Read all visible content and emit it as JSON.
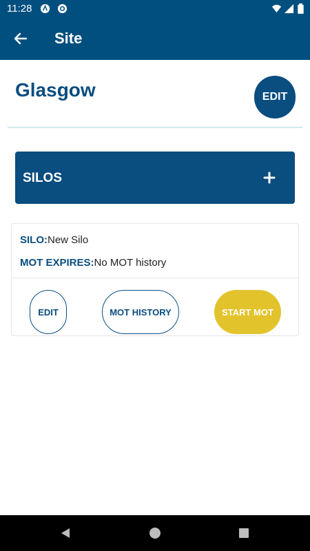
{
  "status_bar": {
    "time": "11:28",
    "icons": [
      "app-notification-icon",
      "at-sign-icon",
      "wifi-icon",
      "signal-icon",
      "battery-icon"
    ]
  },
  "app_bar": {
    "title": "Site",
    "back_icon": "back-arrow-icon"
  },
  "site": {
    "name": "Glasgow",
    "edit_label": "EDIT"
  },
  "silos_section": {
    "title": "SILOS",
    "add_icon": "plus-icon"
  },
  "silo_card": {
    "silo_key": "SILO:",
    "silo_value": "New Silo",
    "mot_key": "MOT EXPIRES:",
    "mot_value": "No MOT history",
    "edit_label": "EDIT",
    "history_label": "MOT HISTORY",
    "start_label": "START MOT"
  },
  "nav_bar": {
    "icons": [
      "back-triangle-icon",
      "home-circle-icon",
      "recents-square-icon"
    ]
  },
  "colors": {
    "primary": "#0a4d7f",
    "status_bar": "#004f7f",
    "accent": "#e3c32c",
    "divider": "#cfe9f0"
  }
}
